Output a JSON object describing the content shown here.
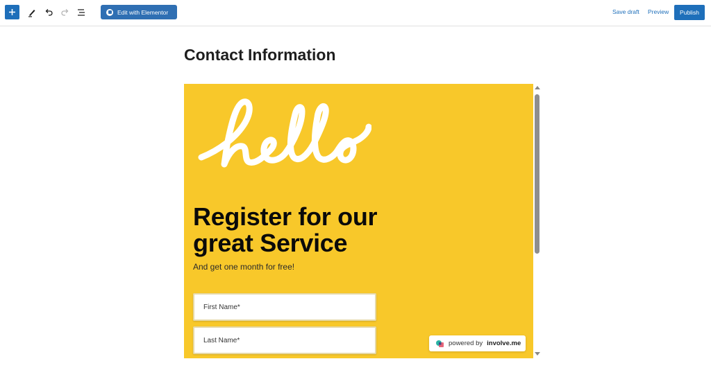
{
  "toolbar": {
    "add_icon": "plus-icon",
    "edit_icon": "pencil-icon",
    "undo_icon": "undo-icon",
    "redo_icon": "redo-icon",
    "outline_icon": "list-view-icon",
    "elementor_label": "Edit with Elementor",
    "save_draft_label": "Save draft",
    "preview_label": "Preview",
    "publish_label": "Publish",
    "accent_color": "#1e6fba"
  },
  "page": {
    "title": "Contact Information"
  },
  "embed": {
    "background_color": "#f8c82a",
    "logo_text": "hello",
    "headline_line1": "Register for our",
    "headline_line2": "great Service",
    "subline": "And get one month for free!",
    "fields": [
      {
        "placeholder": "First Name*"
      },
      {
        "placeholder": "Last Name*"
      }
    ],
    "badge": {
      "prefix": "powered by",
      "brand": "involve.me"
    }
  }
}
